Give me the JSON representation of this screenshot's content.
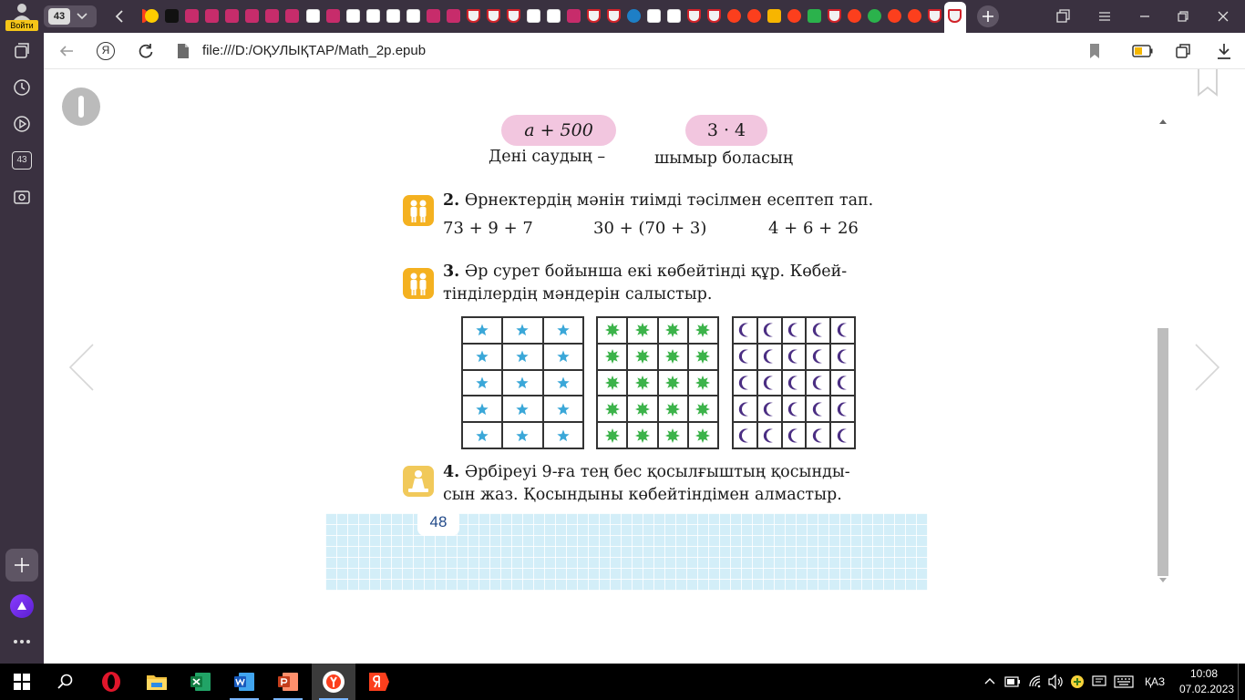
{
  "browser": {
    "login_label": "Войти",
    "tab_count": "43",
    "url": "file:///D:/ОҚУЛЫҚТАР/Math_2p.epub",
    "sidebar_badge": "43"
  },
  "page": {
    "top_pills": [
      "a + 500",
      "3 · 4"
    ],
    "top_captions": [
      "Дені саудың –",
      "шымыр боласың"
    ],
    "task2": {
      "number": "2.",
      "text": "Өрнектердің мәнін тиімді тәсілмен есептеп тап.",
      "expressions": [
        "73 + 9 + 7",
        "30 + (70 + 3)",
        "4 + 6 + 26"
      ]
    },
    "task3": {
      "number": "3.",
      "line1": "Әр сурет бойынша екі көбейтінді құр. Көбей-",
      "line2": "тінділердің мәндерін салыстыр."
    },
    "task4": {
      "number": "4.",
      "line1": "Әрбіреуі 9-ға тең бес қосылғыштың қосынды-",
      "line2": "сын жаз. Қосындыны көбейтіндімен алмастыр."
    },
    "page_number": "48",
    "grids": [
      {
        "rows": 5,
        "cols": 3,
        "symbol": "star",
        "color": "#3aa7d8"
      },
      {
        "rows": 5,
        "cols": 4,
        "symbol": "sun",
        "color": "#3cb34a"
      },
      {
        "rows": 5,
        "cols": 5,
        "symbol": "moon",
        "color": "#4b2e83"
      }
    ]
  },
  "taskbar": {
    "language": "ҚАЗ",
    "time": "10:08",
    "date": "07.02.2023"
  },
  "colors": {
    "chrome_dark": "#3a3140",
    "pill_pink": "#f2c6df",
    "icon_orange": "#f4b120",
    "grid_blue": "#d3eef8"
  }
}
